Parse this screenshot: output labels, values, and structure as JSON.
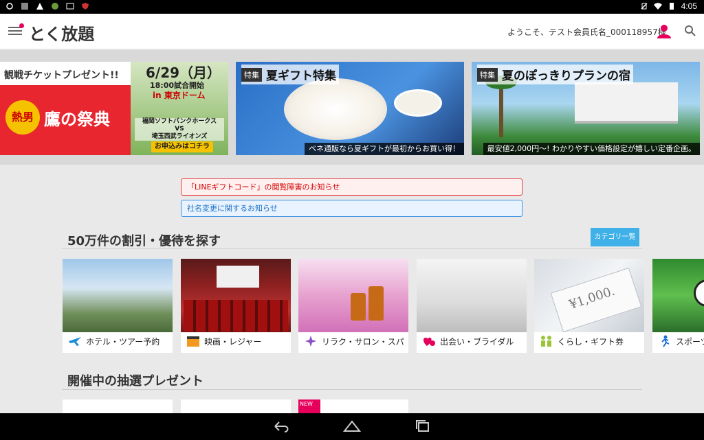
{
  "status": {
    "time": "4:05"
  },
  "header": {
    "brand": "とく放題",
    "welcome": "ようこそ、テスト会員氏名_000118957様"
  },
  "banners": [
    {
      "top_text": "観戦チケットプレゼント!!",
      "circle_text": "熱男",
      "title": "鷹の祭典",
      "date": "6/29（月）",
      "time": "18:00試合開始",
      "venue": "in 東京ドーム",
      "teams_1": "福岡ソフトバンクホークス",
      "teams_vs": "VS",
      "teams_2": "埼玉西武ライオンズ",
      "apply": "お申込みはコチラ"
    },
    {
      "tag": "特集",
      "title": "夏ギフト特集",
      "caption": "ベネ通販なら夏ギフトが最初からお買い得！"
    },
    {
      "tag": "特集",
      "title": "夏のぽっきりプランの宿",
      "caption": "最安値2,000円～! わかりやすい価格設定が嬉しい定番企画。"
    }
  ],
  "notices": [
    {
      "text": "「LINEギフトコード」の閲覧障害のお知らせ"
    },
    {
      "text": "社名変更に関するお知らせ"
    }
  ],
  "section_discounts": {
    "title": "50万件の割引・優待を探す",
    "category_button": "カテゴリ一覧",
    "cards": [
      {
        "label": "ホテル・ツアー予約"
      },
      {
        "label": "映画・レジャー"
      },
      {
        "label": "リラク・サロン・スパ"
      },
      {
        "label": "出会い・ブライダル"
      },
      {
        "label": "くらし・ギフト券",
        "note_text": "¥1,000."
      },
      {
        "label": "スポーツ"
      }
    ]
  },
  "section_lottery": {
    "title": "開催中の抽選プレゼント",
    "new_tag": "NEW"
  },
  "colors": {
    "accent": "#e6005c",
    "category_button": "#3fb0e8",
    "notice_red": "#e43b3b",
    "notice_blue": "#3a8fe0"
  }
}
